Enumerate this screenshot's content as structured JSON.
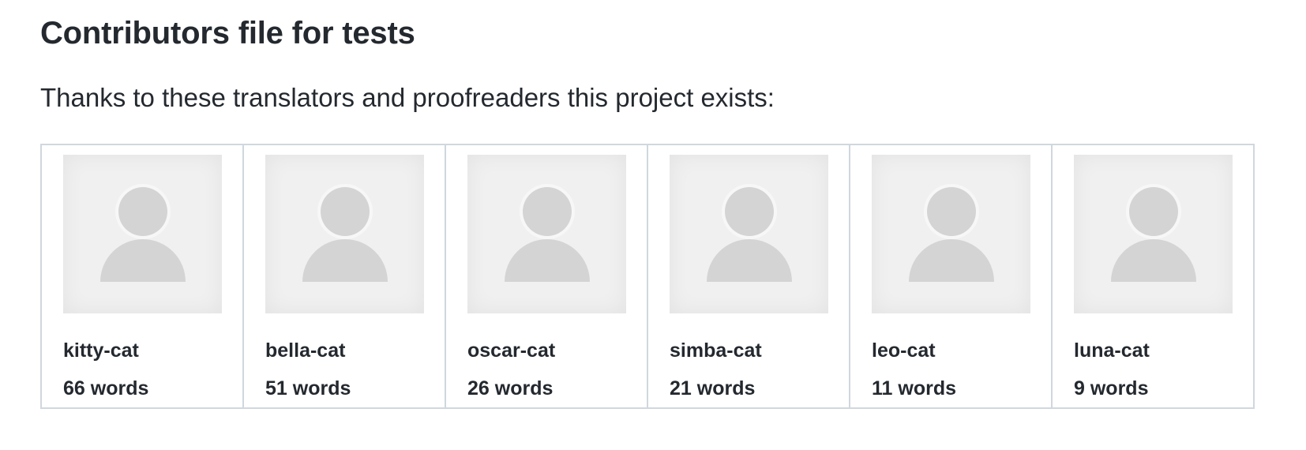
{
  "heading": "Contributors file for tests",
  "intro": "Thanks to these translators and proofreaders this project exists:",
  "contributors": [
    {
      "name": "kitty-cat",
      "words": "66 words",
      "avatar_icon": "default-user-icon"
    },
    {
      "name": "bella-cat",
      "words": "51 words",
      "avatar_icon": "default-user-icon"
    },
    {
      "name": "oscar-cat",
      "words": "26 words",
      "avatar_icon": "default-user-icon"
    },
    {
      "name": "simba-cat",
      "words": "21 words",
      "avatar_icon": "default-user-icon"
    },
    {
      "name": "leo-cat",
      "words": "11 words",
      "avatar_icon": "default-user-icon"
    },
    {
      "name": "luna-cat",
      "words": "9 words",
      "avatar_icon": "default-user-icon"
    }
  ],
  "colors": {
    "text": "#24292f",
    "border": "#d0d7de",
    "avatar_bg": "#f0f0f0",
    "avatar_figure": "#d4d4d4"
  }
}
